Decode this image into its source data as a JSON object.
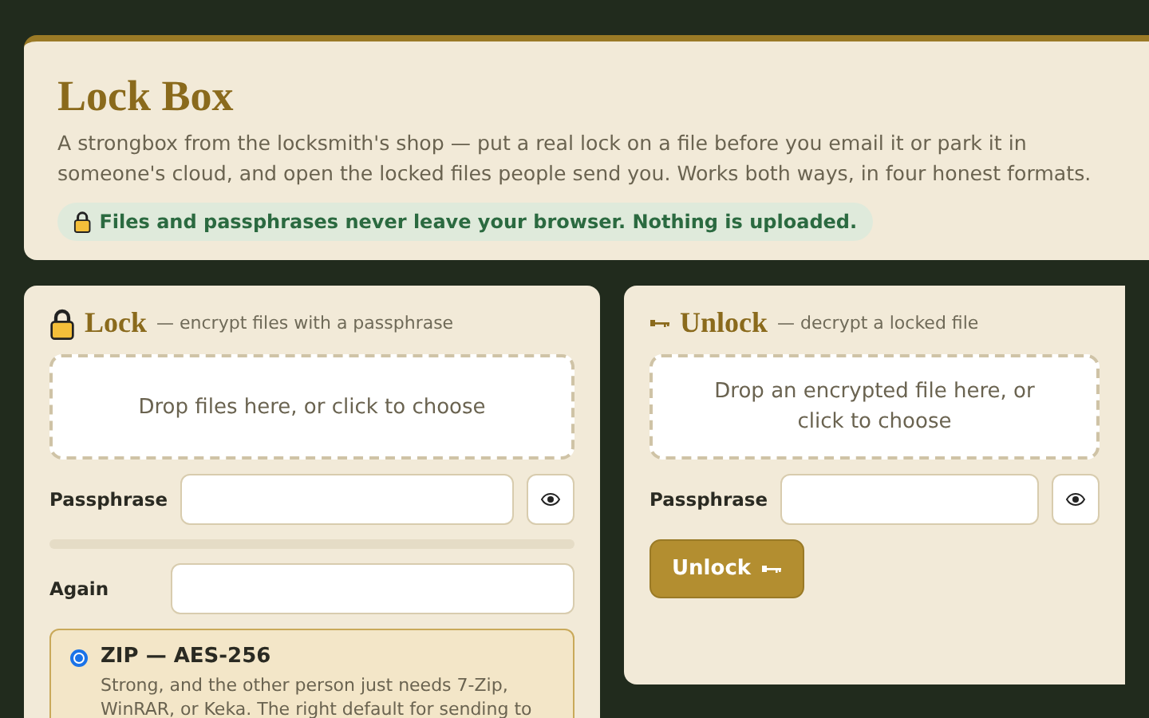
{
  "header": {
    "title": "Lock Box",
    "description": "A strongbox from the locksmith's shop — put a real lock on a file before you email it or park it in someone's cloud, and open the locked files people send you. Works both ways, in four honest formats.",
    "notice": "Files and passphrases never leave your browser. Nothing is uploaded."
  },
  "lock": {
    "title": "Lock",
    "subtitle": "— encrypt files with a passphrase",
    "dropzone": "Drop files here, or click to choose",
    "passphrase_label": "Passphrase",
    "strength": {
      "level": 0
    },
    "again_label": "Again",
    "formats": [
      {
        "name": "ZIP — AES-256",
        "description": "Strong, and the other person just needs 7-Zip, WinRAR, or Keka. The right default for sending to",
        "selected": true
      }
    ]
  },
  "unlock": {
    "title": "Unlock",
    "subtitle": "— decrypt a locked file",
    "dropzone": "Drop an encrypted file here, or click to choose",
    "passphrase_label": "Passphrase",
    "button": "Unlock"
  }
}
